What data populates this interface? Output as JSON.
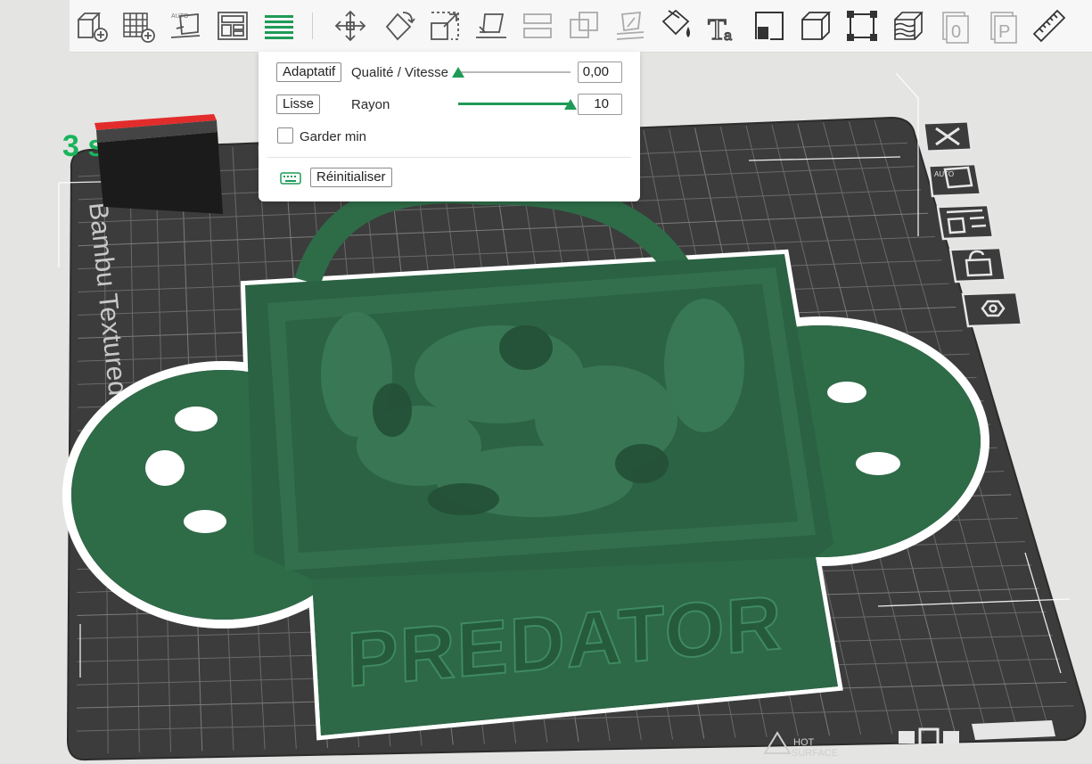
{
  "toolbar": {
    "buttons": [
      {
        "name": "add-cube-icon"
      },
      {
        "name": "add-plate-icon"
      },
      {
        "name": "auto-orient-icon"
      },
      {
        "name": "arrange-icon"
      },
      {
        "name": "layers-icon"
      },
      {
        "name": "move-icon"
      },
      {
        "name": "rotate-icon"
      },
      {
        "name": "scale-icon"
      },
      {
        "name": "lay-on-face-icon"
      },
      {
        "name": "cut-icon"
      },
      {
        "name": "mesh-boolean-icon"
      },
      {
        "name": "support-paint-icon"
      },
      {
        "name": "color-paint-icon"
      },
      {
        "name": "text-icon"
      },
      {
        "name": "seam-icon"
      },
      {
        "name": "cube-view-icon"
      },
      {
        "name": "bounding-box-icon"
      },
      {
        "name": "variable-layer-height-icon"
      },
      {
        "name": "object-label-icon"
      },
      {
        "name": "plate-label-icon"
      },
      {
        "name": "measure-ruler-icon"
      }
    ]
  },
  "panel": {
    "adaptive_button": "Adaptatif",
    "quality_label": "Qualité / Vitesse",
    "quality_value": "0,00",
    "quality_fraction": 0.0,
    "smooth_button": "Lisse",
    "radius_label": "Rayon",
    "radius_value": "10",
    "radius_fraction": 1.0,
    "keep_min_label": "Garder min",
    "keep_min_checked": false,
    "keyboard_icon": "keyboard-icon",
    "reset_button": "Réinitialiser"
  },
  "viewport": {
    "plate_text": "Bambu Textured PEI",
    "watermark_text": "3      s H",
    "model_text": "PREDATOR",
    "hot_surface_top": "HOT",
    "hot_surface_bottom": "SURFACE",
    "colors": {
      "background": "#e4e4e2",
      "plate": "#3c3c3c",
      "grid": "#6a6a6a",
      "model": "#2e6b47",
      "model_dark": "#245638",
      "accent": "#1f9b57"
    }
  },
  "side_tools": [
    {
      "name": "close-icon"
    },
    {
      "name": "auto-orient-plate-icon"
    },
    {
      "name": "arrange-plate-icon"
    },
    {
      "name": "lock-icon"
    },
    {
      "name": "plate-settings-icon"
    }
  ]
}
